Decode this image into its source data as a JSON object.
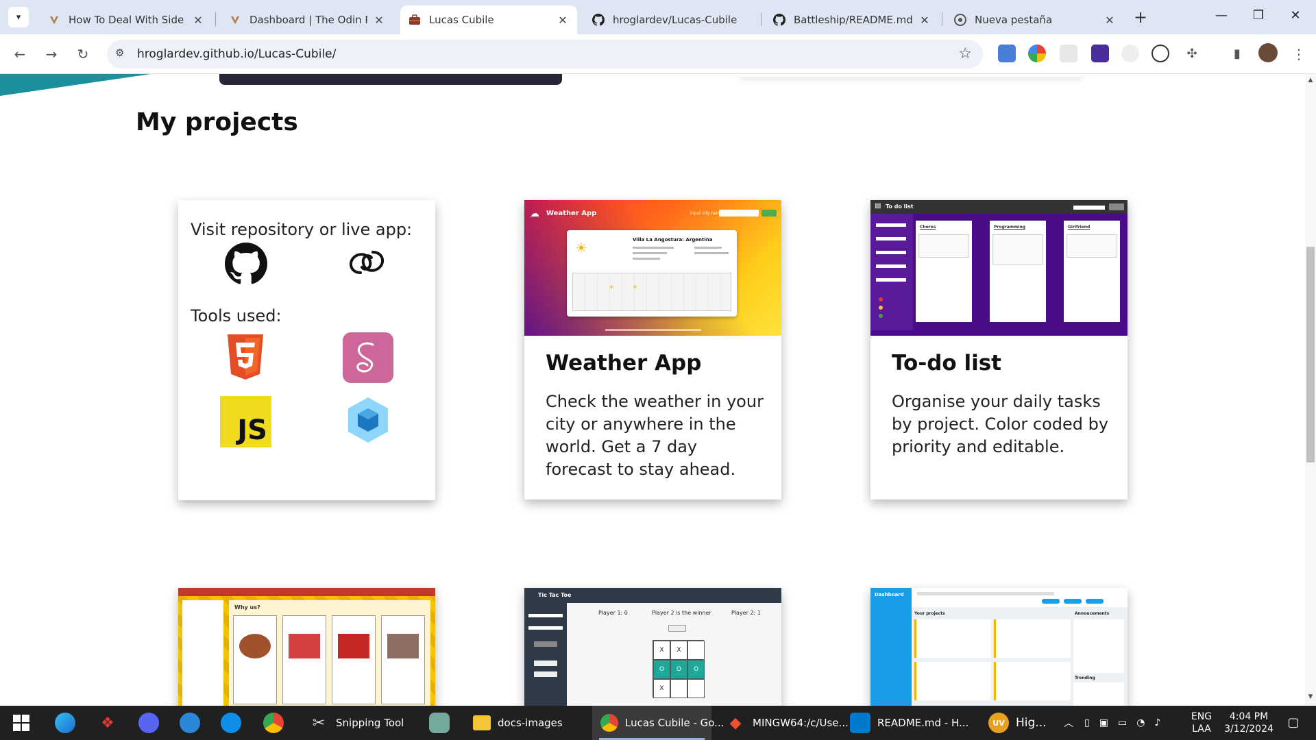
{
  "browser": {
    "tabs": [
      {
        "title": "How To Deal With Side Effe",
        "icon": "odin-icon",
        "active": false
      },
      {
        "title": "Dashboard | The Odin Proj",
        "icon": "odin-icon",
        "active": false
      },
      {
        "title": "Lucas Cubile",
        "icon": "briefcase-icon",
        "active": true
      },
      {
        "title": "hroglardev/Lucas-Cubile",
        "icon": "github-icon",
        "active": false
      },
      {
        "title": "Battleship/README.md at",
        "icon": "github-icon",
        "active": false
      },
      {
        "title": "Nueva pestaña",
        "icon": "chrome-icon",
        "active": false
      }
    ],
    "url": "hroglardev.github.io/Lucas-Cubile/"
  },
  "page": {
    "section_title": "My projects",
    "info_card": {
      "visit_label": "Visit repository or live app:",
      "tools_label": "Tools used:",
      "js_label": "JS",
      "links": [
        "github-icon",
        "live-app-link-icon"
      ],
      "tools": [
        "html5-icon",
        "sass-icon",
        "javascript-icon",
        "webpack-icon"
      ]
    },
    "projects": [
      {
        "title": "Weather App",
        "description": "Check the weather in your city or anywhere in the world. Get a 7 day forecast to stay ahead."
      },
      {
        "title": "To-do list",
        "description": "Organise your daily tasks by project. Color coded by priority and editable."
      }
    ],
    "weather_shot": {
      "app_name": "Weather App",
      "input_label": "Input city name:",
      "city": "Villa La Angostura: Argentina"
    },
    "todo_shot": {
      "app_name": "To do list",
      "columns": [
        "Chores",
        "Programming",
        "Girlfriend"
      ]
    },
    "restaurant_shot": {
      "title": "Why us?"
    },
    "tictactoe_shot": {
      "app_name": "Tic Tac Toe",
      "player1": "Player 1: 0",
      "winner": "Player 2 is the winner",
      "player2": "Player 2: 1",
      "board": [
        "X",
        "X",
        "",
        "O",
        "O",
        "O",
        "X",
        "",
        ""
      ]
    },
    "dashboard_shot": {
      "app_name": "Dashboard",
      "projects_label": "Your projects",
      "announcements_label": "Annoucements",
      "trending_label": "Trending"
    }
  },
  "taskbar": {
    "items": [
      {
        "label": "Snipping Tool",
        "icon": "snipping-tool-icon"
      },
      {
        "label": "docs-images",
        "icon": "folder-icon"
      },
      {
        "label": "Lucas Cubile - Go...",
        "icon": "chrome-icon"
      },
      {
        "label": "MINGW64:/c/Use...",
        "icon": "git-bash-icon"
      },
      {
        "label": "README.md - H...",
        "icon": "vscode-icon"
      },
      {
        "label": "Hig...",
        "icon": "avatar-uv-icon",
        "badge": "UV"
      }
    ],
    "lang_top": "ENG",
    "lang_bottom": "LAA",
    "time": "4:04 PM",
    "date": "3/12/2024"
  },
  "colors": {
    "tab_strip": "#dfe6f3",
    "teal_accent": "#1b8f9b",
    "taskbar": "#202020",
    "js_yellow": "#f0db1e",
    "sass_pink": "#cd6799",
    "html_orange": "#e44d26"
  }
}
